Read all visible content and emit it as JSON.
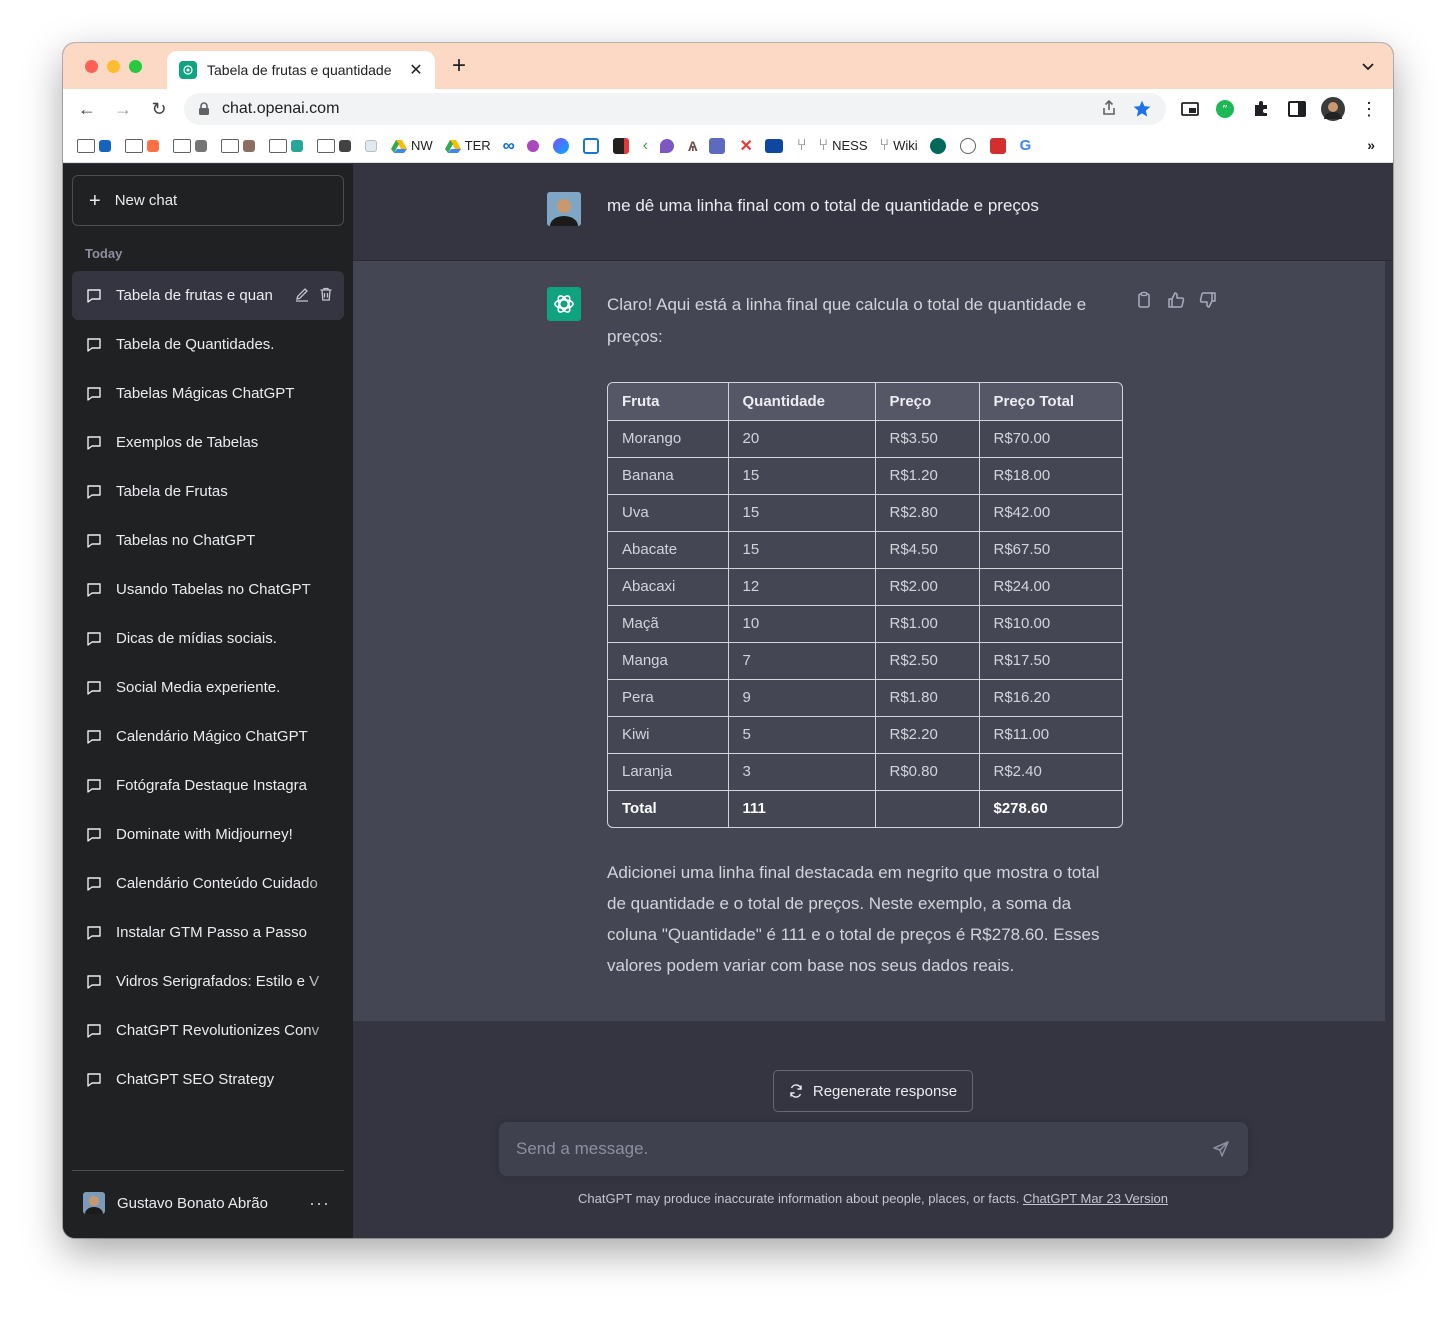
{
  "browser": {
    "tab_title": "Tabela de frutas e quantidade",
    "new_tab": "+",
    "url": "chat.openai.com",
    "bookmarks": [
      {
        "type": "folder",
        "label": ""
      },
      {
        "type": "folder",
        "label": ""
      },
      {
        "type": "folder",
        "label": ""
      },
      {
        "type": "folder",
        "label": ""
      },
      {
        "type": "folder",
        "label": ""
      },
      {
        "type": "folder",
        "label": ""
      },
      {
        "type": "link",
        "label": "NW"
      },
      {
        "type": "link",
        "label": "TER"
      },
      {
        "type": "link",
        "label": "NESS"
      },
      {
        "type": "link",
        "label": "Wiki"
      }
    ],
    "bookmarks_overflow": "»"
  },
  "sidebar": {
    "new_chat_label": "New chat",
    "section_label": "Today",
    "chats": [
      "Tabela de frutas e quan",
      "Tabela de Quantidades.",
      "Tabelas Mágicas ChatGPT",
      "Exemplos de Tabelas",
      "Tabela de Frutas",
      "Tabelas no ChatGPT",
      "Usando Tabelas no ChatGPT",
      "Dicas de mídias sociais.",
      "Social Media experiente.",
      "Calendário Mágico ChatGPT",
      "Fotógrafa Destaque Instagra",
      "Dominate with Midjourney!",
      "Calendário Conteúdo Cuidado",
      "Instalar GTM Passo a Passo",
      "Vidros Serigrafados: Estilo e V",
      "ChatGPT Revolutionizes Conv",
      "ChatGPT SEO Strategy"
    ],
    "user_name": "Gustavo Bonato Abrão",
    "user_menu": "···"
  },
  "conversation": {
    "user_message": "me dê uma linha final com o total de quantidade e preços",
    "bot_intro": "Claro! Aqui está a linha final que calcula o total de quantidade e preços:",
    "table": {
      "headers": [
        "Fruta",
        "Quantidade",
        "Preço",
        "Preço Total"
      ],
      "rows": [
        [
          "Morango",
          "20",
          "R$3.50",
          "R$70.00"
        ],
        [
          "Banana",
          "15",
          "R$1.20",
          "R$18.00"
        ],
        [
          "Uva",
          "15",
          "R$2.80",
          "R$42.00"
        ],
        [
          "Abacate",
          "15",
          "R$4.50",
          "R$67.50"
        ],
        [
          "Abacaxi",
          "12",
          "R$2.00",
          "R$24.00"
        ],
        [
          "Maçã",
          "10",
          "R$1.00",
          "R$10.00"
        ],
        [
          "Manga",
          "7",
          "R$2.50",
          "R$17.50"
        ],
        [
          "Pera",
          "9",
          "R$1.80",
          "R$16.20"
        ],
        [
          "Kiwi",
          "5",
          "R$2.20",
          "R$11.00"
        ],
        [
          "Laranja",
          "3",
          "R$0.80",
          "R$2.40"
        ],
        [
          "Total",
          "111",
          "",
          "$278.60"
        ]
      ]
    },
    "bot_outro": "Adicionei uma linha final destacada em negrito que mostra o total de quantidade e o total de preços. Neste exemplo, a soma da coluna \"Quantidade\" é 111 e o total de preços é R$278.60. Esses valores podem variar com base nos seus dados reais."
  },
  "composer": {
    "regenerate_label": "Regenerate response",
    "placeholder": "Send a message.",
    "disclaimer_text": "ChatGPT may produce inaccurate information about people, places, or facts. ",
    "disclaimer_link": "ChatGPT Mar 23 Version"
  },
  "colors": {
    "sidebar_bg": "#202123",
    "main_bg": "#343541",
    "bot_bg": "#444654",
    "accent": "#10a37f",
    "tabstrip": "#fcd9c5"
  }
}
